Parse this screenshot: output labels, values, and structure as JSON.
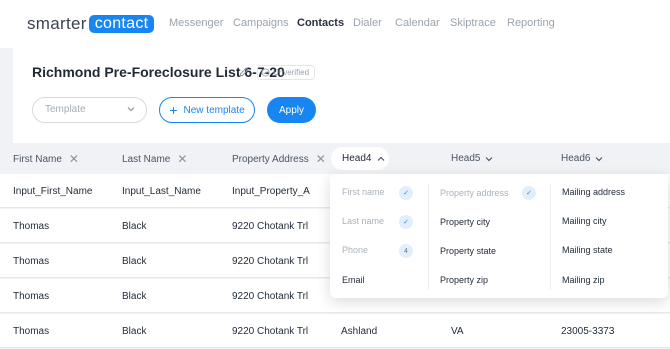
{
  "brand": {
    "name_part1": "smarter",
    "name_part2": "contact"
  },
  "nav": [
    {
      "label": "Messenger"
    },
    {
      "label": "Campaigns"
    },
    {
      "label": "Contacts"
    },
    {
      "label": "Dialer"
    },
    {
      "label": "Calendar"
    },
    {
      "label": "Skiptrace"
    },
    {
      "label": "Reporting"
    }
  ],
  "active_nav": "Contacts",
  "list": {
    "title": "Richmond Pre-Foreclosure List 6-7-20",
    "status": "Unverified"
  },
  "controls": {
    "template_placeholder": "Template",
    "new_template_label": "New template",
    "apply_label": "Apply"
  },
  "columns": [
    {
      "label": "First Name"
    },
    {
      "label": "Last Name"
    },
    {
      "label": "Property Address"
    },
    {
      "label": "Head4"
    },
    {
      "label": "Head5"
    },
    {
      "label": "Head6"
    }
  ],
  "rows": [
    [
      "Input_First_Name",
      "Input_Last_Name",
      "Input_Property_A",
      "",
      "",
      ""
    ],
    [
      "Thomas",
      "Black",
      "9220 Chotank Trl",
      "",
      "",
      ""
    ],
    [
      "Thomas",
      "Black",
      "9220 Chotank Trl",
      "",
      "",
      ""
    ],
    [
      "Thomas",
      "Black",
      "9220 Chotank Trl",
      "",
      "",
      ""
    ],
    [
      "Thomas",
      "Black",
      "9220 Chotank Trl",
      "Ashland",
      "VA",
      "23005-3373"
    ]
  ],
  "mapping_dropdown": {
    "col1": [
      {
        "label": "First name",
        "state": "checked"
      },
      {
        "label": "Last name",
        "state": "checked"
      },
      {
        "label": "Phone",
        "state": "count",
        "count": "4"
      },
      {
        "label": "Email",
        "state": "none"
      }
    ],
    "col2": [
      {
        "label": "Property address",
        "state": "checked"
      },
      {
        "label": "Property city",
        "state": "none"
      },
      {
        "label": "Property state",
        "state": "none"
      },
      {
        "label": "Property zip",
        "state": "none"
      }
    ],
    "col3": [
      {
        "label": "Mailing address",
        "state": "none"
      },
      {
        "label": "Mailing city",
        "state": "none"
      },
      {
        "label": "Mailing state",
        "state": "none"
      },
      {
        "label": "Mailing zip",
        "state": "none"
      }
    ]
  },
  "colors": {
    "accent": "#1886f2",
    "page_bg": "#f0f2f5",
    "muted_text": "#9aa3ad"
  }
}
